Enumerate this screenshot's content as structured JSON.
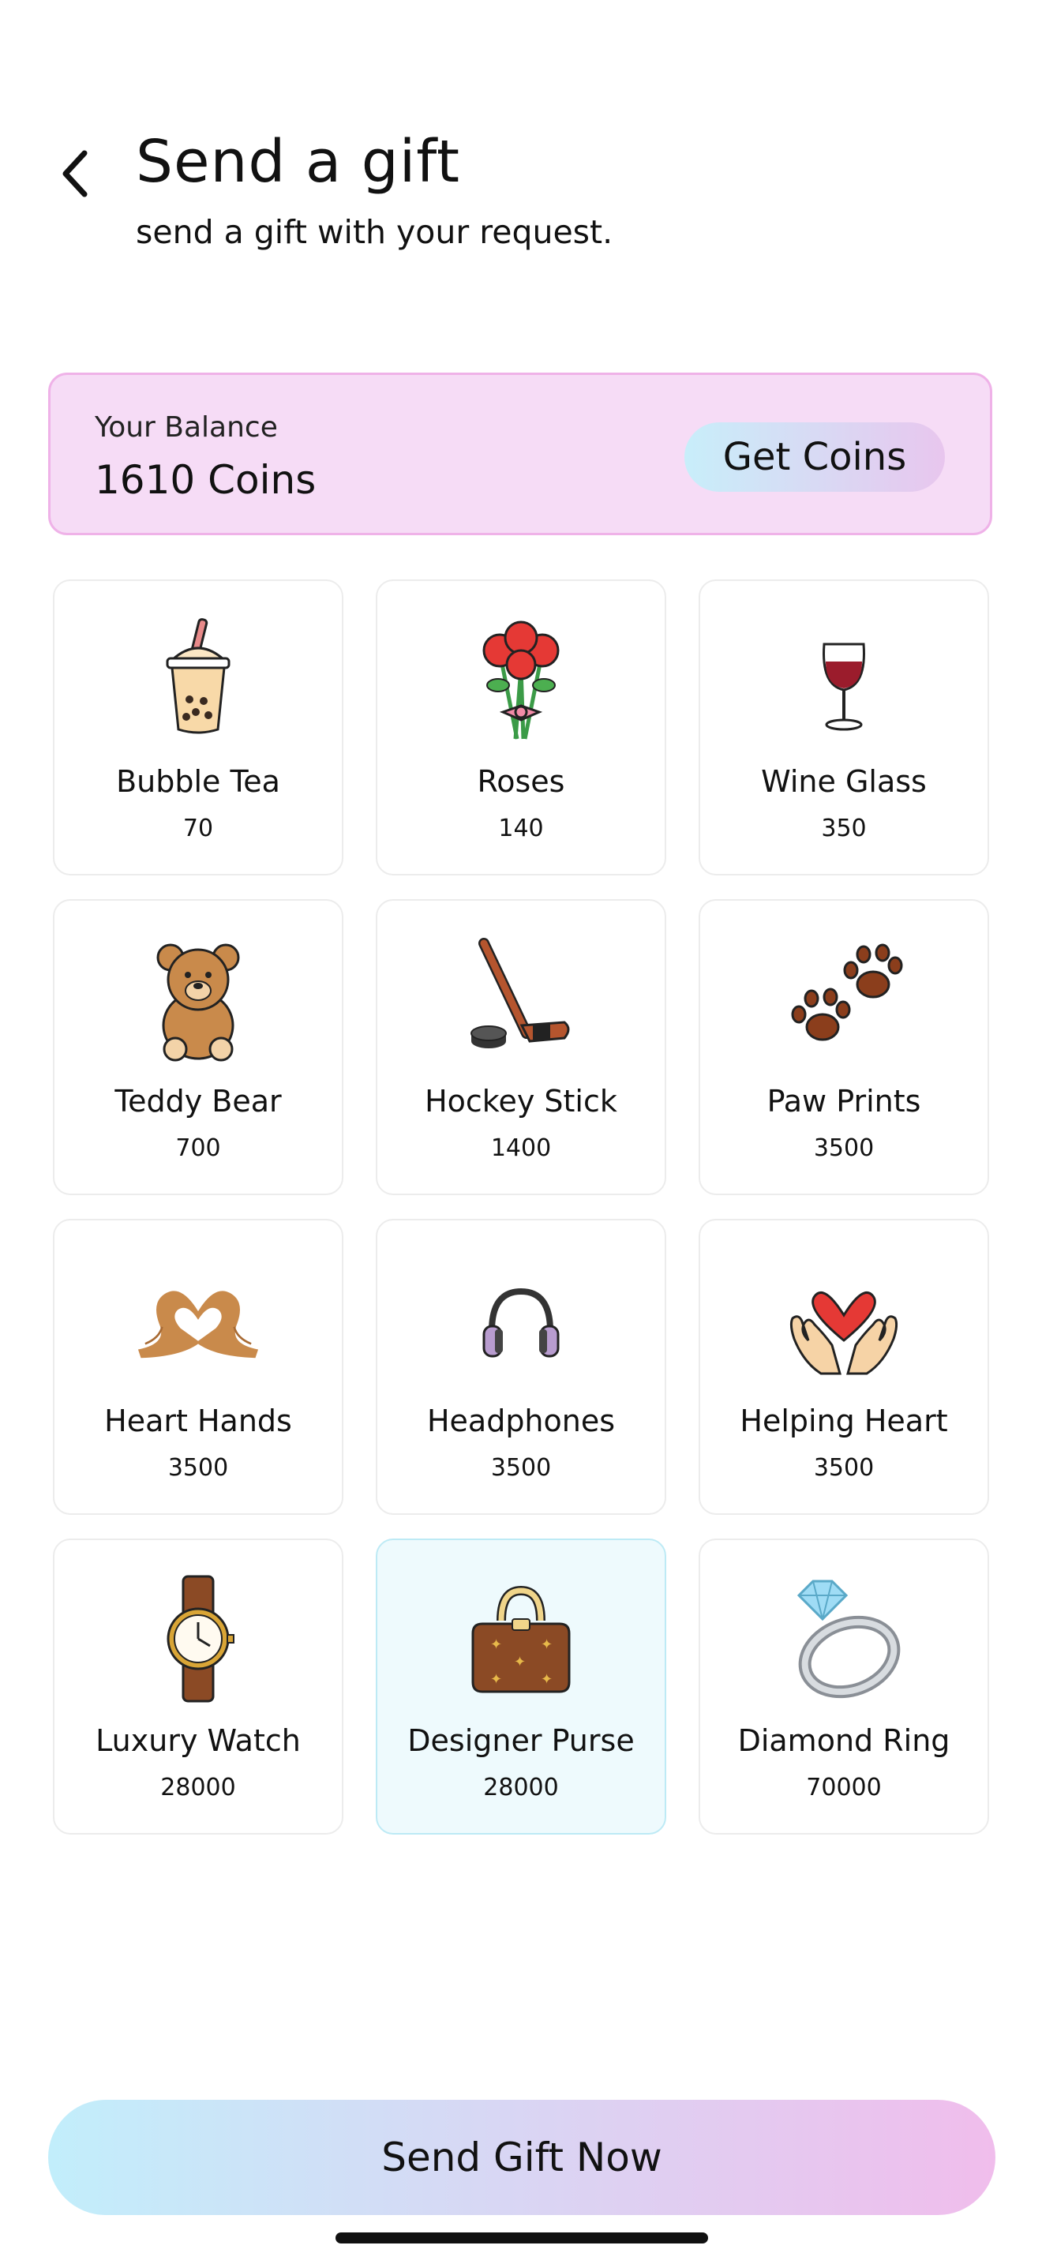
{
  "header": {
    "title": "Send a gift",
    "subtitle": "send a gift with your request."
  },
  "balance": {
    "label": "Your Balance",
    "value": "1610 Coins",
    "get_coins_label": "Get Coins"
  },
  "gifts": [
    {
      "name": "Bubble Tea",
      "price": "70",
      "icon": "bubble-tea-icon"
    },
    {
      "name": "Roses",
      "price": "140",
      "icon": "roses-icon"
    },
    {
      "name": "Wine Glass",
      "price": "350",
      "icon": "wine-glass-icon"
    },
    {
      "name": "Teddy Bear",
      "price": "700",
      "icon": "teddy-bear-icon"
    },
    {
      "name": "Hockey Stick",
      "price": "1400",
      "icon": "hockey-stick-icon"
    },
    {
      "name": "Paw Prints",
      "price": "3500",
      "icon": "paw-prints-icon"
    },
    {
      "name": "Heart Hands",
      "price": "3500",
      "icon": "heart-hands-icon"
    },
    {
      "name": "Headphones",
      "price": "3500",
      "icon": "headphones-icon"
    },
    {
      "name": "Helping Heart",
      "price": "3500",
      "icon": "helping-heart-icon"
    },
    {
      "name": "Luxury Watch",
      "price": "28000",
      "icon": "luxury-watch-icon"
    },
    {
      "name": "Designer Purse",
      "price": "28000",
      "icon": "designer-purse-icon",
      "selected": true
    },
    {
      "name": "Diamond Ring",
      "price": "70000",
      "icon": "diamond-ring-icon"
    }
  ],
  "footer": {
    "send_label": "Send Gift Now"
  },
  "colors": {
    "balance_bg": "#f6dcf6",
    "balance_border": "#efb2e8",
    "selected_bg": "#eefafd",
    "gradient_start": "#c2eefb",
    "gradient_end": "#f0bdec"
  }
}
